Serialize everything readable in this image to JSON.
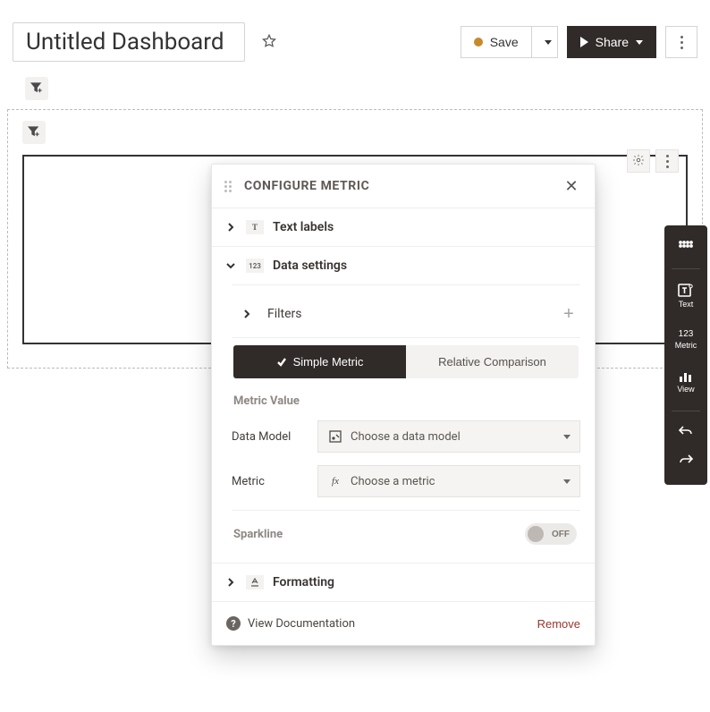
{
  "header": {
    "title": "Untitled Dashboard",
    "save": "Save",
    "share": "Share"
  },
  "right_rail": {
    "text": "Text",
    "metric_sub": "123",
    "metric": "Metric",
    "view": "View"
  },
  "panel": {
    "title": "CONFIGURE METRIC",
    "sections": {
      "text_labels": {
        "badge": "T",
        "label": "Text labels"
      },
      "data_settings": {
        "badge": "123",
        "label": "Data settings"
      },
      "filters": "Filters",
      "simple_metric": "Simple Metric",
      "relative_comparison": "Relative Comparison",
      "metric_value_heading": "Metric Value",
      "data_model_label": "Data Model",
      "data_model_placeholder": "Choose a data model",
      "metric_label": "Metric",
      "metric_placeholder": "Choose a metric",
      "sparkline_label": "Sparkline",
      "sparkline_state": "OFF",
      "formatting": {
        "label": "Formatting"
      }
    },
    "footer": {
      "doc": "View Documentation",
      "remove": "Remove"
    }
  }
}
